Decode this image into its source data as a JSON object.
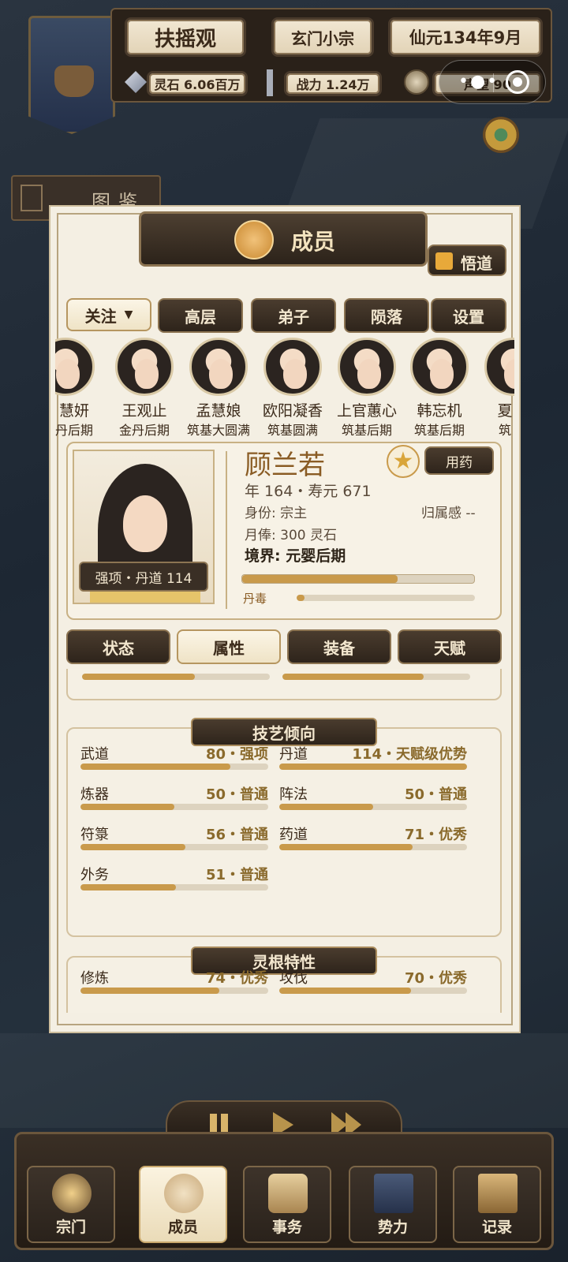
{
  "header": {
    "sect_name": "扶摇观",
    "sect_rank": "玄门小宗",
    "date": "仙元134年9月",
    "spirit_stones": "灵石 6.06百万",
    "combat": "战力 1.24万",
    "prestige": "声望 90"
  },
  "sidebar": {
    "codex_label": "图鉴"
  },
  "panel": {
    "title": "成员",
    "insight_label": "悟道"
  },
  "filters": {
    "follow_label": "关注",
    "senior_label": "高层",
    "disciple_label": "弟子",
    "fallen_label": "陨落",
    "settings_label": "设置"
  },
  "members": [
    {
      "name": "慧妍",
      "rank": "丹后期"
    },
    {
      "name": "王观止",
      "rank": "金丹后期"
    },
    {
      "name": "孟慧娘",
      "rank": "筑基大圆满"
    },
    {
      "name": "欧阳凝香",
      "rank": "筑基圆满"
    },
    {
      "name": "上官蕙心",
      "rank": "筑基后期"
    },
    {
      "name": "韩忘机",
      "rank": "筑基后期"
    },
    {
      "name": "夏",
      "rank": "筑"
    }
  ],
  "profile": {
    "name": "顾兰若",
    "age_line": "年 164・寿元 671",
    "identity": "身份: 宗主",
    "belonging": "归属感 --",
    "salary": "月俸: 300 灵石",
    "realm": "境界: 元婴后期",
    "strength": "强项・丹道 114",
    "medicine_label": "用药",
    "pill_poison_label": "丹毒",
    "cultivation_progress": 0.67,
    "pill_poison": 0.03
  },
  "tabs": {
    "status": "状态",
    "attributes": "属性",
    "equipment": "装备",
    "talent": "天赋"
  },
  "skills": {
    "title": "技艺倾向",
    "items": [
      {
        "label": "武道",
        "value": "80・强项",
        "level": 0.8
      },
      {
        "label": "丹道",
        "value": "114・天赋级优势",
        "level": 1.0
      },
      {
        "label": "炼器",
        "value": "50・普通",
        "level": 0.5
      },
      {
        "label": "阵法",
        "value": "50・普通",
        "level": 0.5
      },
      {
        "label": "符箓",
        "value": "56・普通",
        "level": 0.56
      },
      {
        "label": "药道",
        "value": "71・优秀",
        "level": 0.71
      },
      {
        "label": "外务",
        "value": "51・普通",
        "level": 0.51
      }
    ]
  },
  "spirit_root": {
    "title": "灵根特性",
    "items": [
      {
        "label": "修炼",
        "value": "74・优秀",
        "level": 0.74
      },
      {
        "label": "攻伐",
        "value": "70・优秀",
        "level": 0.7
      }
    ]
  },
  "nav": {
    "sect": "宗门",
    "members": "成员",
    "affairs": "事务",
    "forces": "势力",
    "records": "记录"
  },
  "colors": {
    "accent": "#c99a4b",
    "dark_wood": "#2e241b",
    "parchment": "#f4efe3"
  }
}
